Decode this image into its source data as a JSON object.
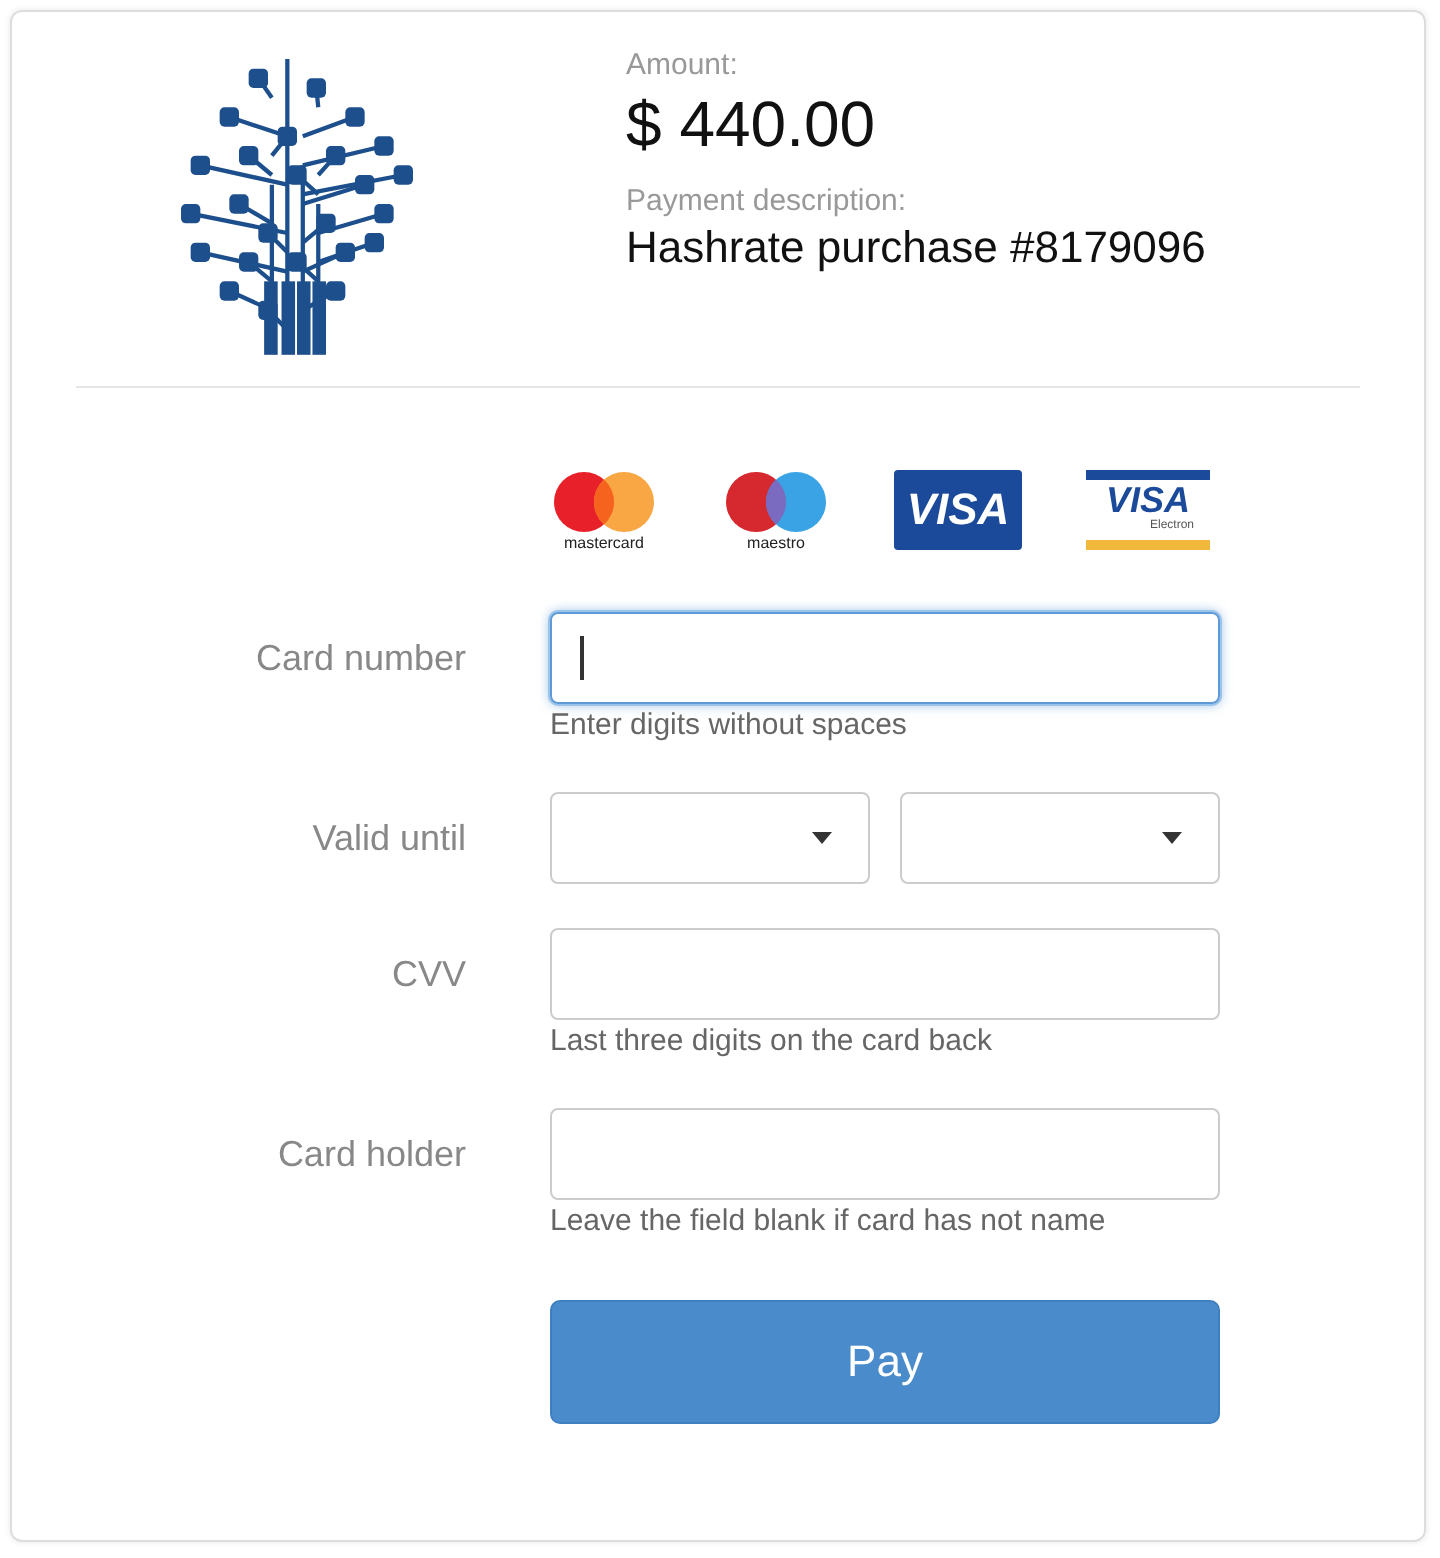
{
  "amount": {
    "label": "Amount:",
    "value": "$ 440.00"
  },
  "description": {
    "label": "Payment description:",
    "value": "Hashrate purchase #8179096"
  },
  "cards": [
    {
      "kind": "mastercard",
      "label": "mastercard"
    },
    {
      "kind": "maestro",
      "label": "maestro"
    },
    {
      "kind": "visa",
      "label": "VISA"
    },
    {
      "kind": "visa_electron",
      "label": "VISA",
      "sublabel": "Electron"
    }
  ],
  "fields": [
    {
      "kind": "text",
      "label": "Card number",
      "focused": true,
      "hint": "Enter digits without spaces"
    },
    {
      "kind": "select",
      "label": "Valid until",
      "dropdowns": [
        {
          "focused": false
        },
        {
          "focused": false
        }
      ]
    },
    {
      "kind": "text",
      "label": "CVV",
      "focused": false,
      "hint": "Last three digits on the card back"
    },
    {
      "kind": "text",
      "label": "Card holder",
      "focused": false,
      "hint": "Leave the field blank if card has not name"
    }
  ],
  "pay_button": "Pay"
}
